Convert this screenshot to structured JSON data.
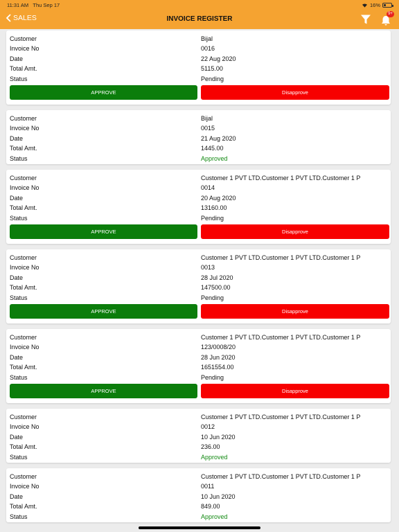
{
  "status_bar": {
    "time": "11:31 AM",
    "date": "Thu Sep 17",
    "battery": "16%"
  },
  "nav": {
    "back_label": "SALES",
    "title": "INVOICE REGISTER",
    "badge": "9+"
  },
  "labels": {
    "customer": "Customer",
    "invoice_no": "Invoice No",
    "date": "Date",
    "total": "Total Amt.",
    "status": "Status"
  },
  "actions": {
    "approve": "APPROVE",
    "disapprove": "Disapprove"
  },
  "colors": {
    "brand": "#f5a331",
    "approve": "#0b7d0b",
    "disapprove": "#f70000",
    "approved_text": "#138a13"
  },
  "invoices": [
    {
      "customer": "Bijal",
      "invoice_no": "0016",
      "date": "22 Aug 2020",
      "total": "5115.00",
      "status": "Pending"
    },
    {
      "customer": "Bijal",
      "invoice_no": "0015",
      "date": "21 Aug 2020",
      "total": "1445.00",
      "status": "Approved"
    },
    {
      "customer": "Customer 1 PVT LTD.Customer 1 PVT LTD.Customer 1 P",
      "invoice_no": "0014",
      "date": "20 Aug 2020",
      "total": "13160.00",
      "status": "Pending"
    },
    {
      "customer": "Customer 1 PVT LTD.Customer 1 PVT LTD.Customer 1 P",
      "invoice_no": "0013",
      "date": "28 Jul 2020",
      "total": "147500.00",
      "status": "Pending"
    },
    {
      "customer": "Customer 1 PVT LTD.Customer 1 PVT LTD.Customer 1 P",
      "invoice_no": "123/0008/20",
      "date": "28 Jun 2020",
      "total": "1651554.00",
      "status": "Pending"
    },
    {
      "customer": "Customer 1 PVT LTD.Customer 1 PVT LTD.Customer 1 P",
      "invoice_no": "0012",
      "date": "10 Jun 2020",
      "total": "236.00",
      "status": "Approved"
    },
    {
      "customer": "Customer 1 PVT LTD.Customer 1 PVT LTD.Customer 1 P",
      "invoice_no": "0011",
      "date": "10 Jun 2020",
      "total": "849.00",
      "status": "Approved"
    }
  ]
}
